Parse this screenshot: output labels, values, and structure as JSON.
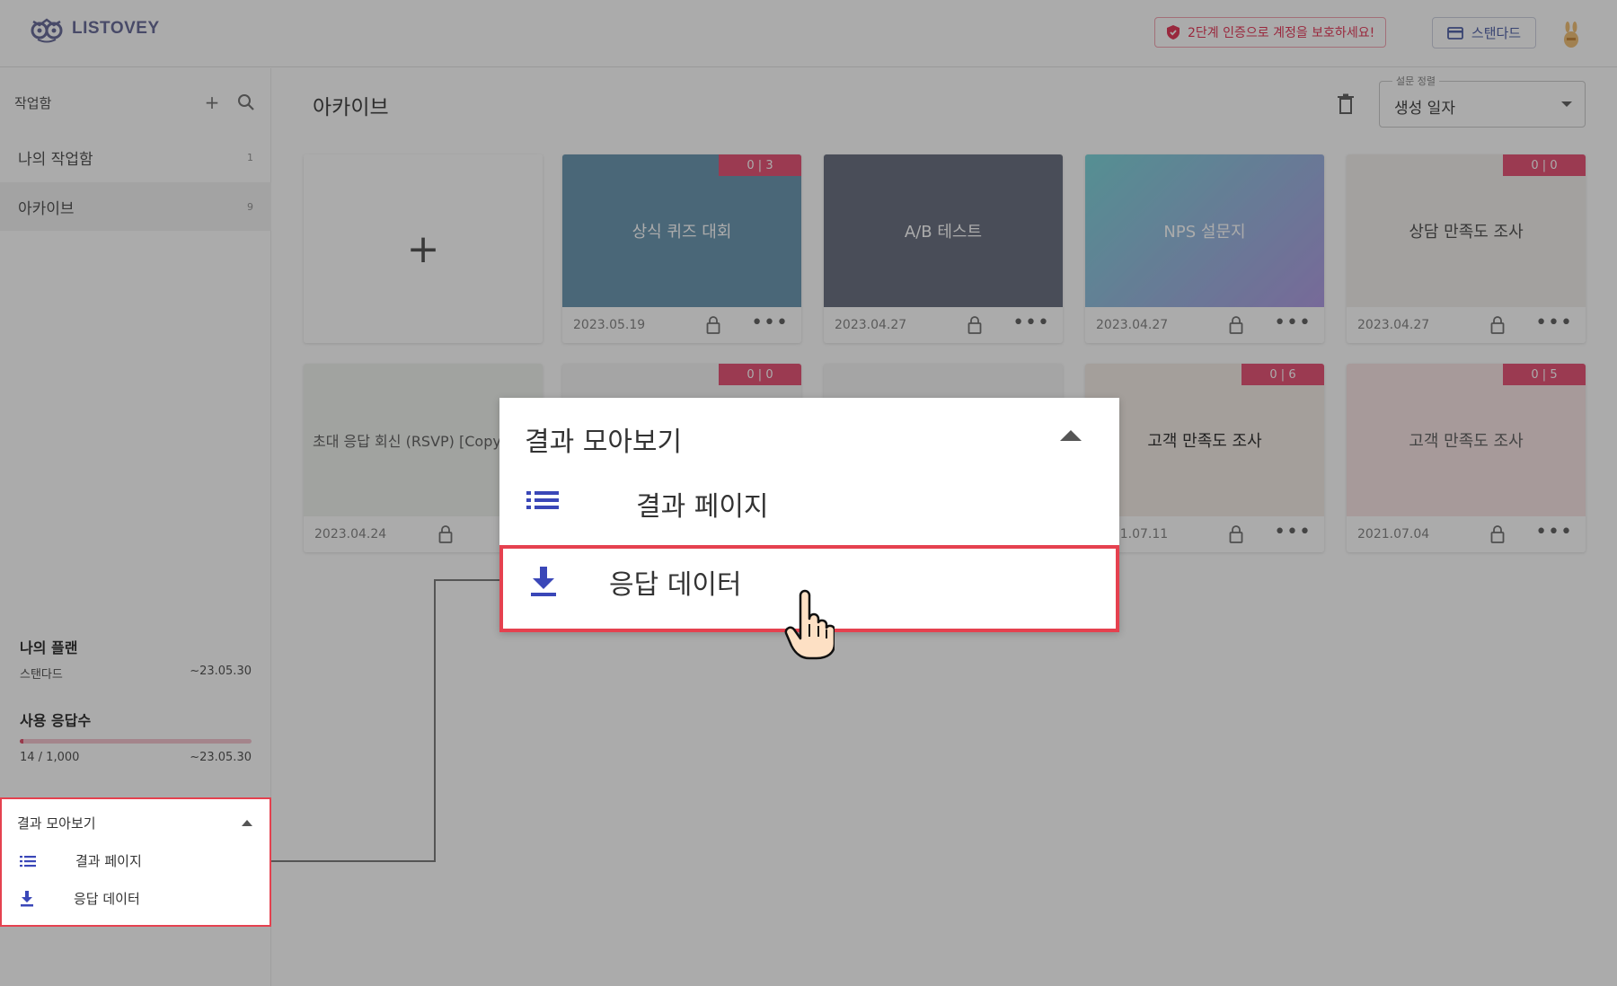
{
  "header": {
    "logo_text": "LISTOVEY",
    "security_notice": "2단계 인증으로 계정을 보호하세요!",
    "plan_button": "스탠다드"
  },
  "sidebar": {
    "title": "작업함",
    "items": [
      {
        "label": "나의 작업함",
        "count": "1"
      },
      {
        "label": "아카이브",
        "count": "9"
      }
    ],
    "plan": {
      "title": "나의 플랜",
      "name": "스탠다드",
      "expiry": "~23.05.30",
      "usage_title": "사용 응답수",
      "usage": "14 / 1,000",
      "usage_fraction": 0.014,
      "usage_expiry": "~23.05.30"
    },
    "results_menu": {
      "title": "결과 모아보기",
      "items": [
        {
          "label": "결과 페이지",
          "icon": "list-icon"
        },
        {
          "label": "응답 데이터",
          "icon": "download-icon"
        }
      ]
    }
  },
  "main": {
    "title": "아카이브",
    "sort": {
      "label": "설문 정렬",
      "value": "생성 일자"
    },
    "cards": [
      {
        "title": "",
        "date": "",
        "badge": "",
        "type": "add"
      },
      {
        "title": "상식 퀴즈 대회",
        "date": "2023.05.19",
        "badge": "0 | 3"
      },
      {
        "title": "A/B 테스트",
        "date": "2023.04.27",
        "badge": ""
      },
      {
        "title": "NPS 설문지",
        "date": "2023.04.27",
        "badge": ""
      },
      {
        "title": "상담 만족도 조사",
        "date": "2023.04.27",
        "badge": "0 | 0"
      },
      {
        "title": "초대 응답 회신 (RSVP) [Copy]",
        "date": "2023.04.24",
        "badge": ""
      },
      {
        "title": "",
        "date": "",
        "badge": "0 | 0"
      },
      {
        "title": "",
        "date": "",
        "badge": ""
      },
      {
        "title": "고객 만족도 조사",
        "date": "2021.07.11",
        "badge": "0 | 6"
      },
      {
        "title": "고객 만족도 조사",
        "date": "2021.07.04",
        "badge": "0 | 5"
      }
    ]
  },
  "popup": {
    "title": "결과 모아보기",
    "items": [
      {
        "label": "결과 페이지"
      },
      {
        "label": "응답 데이터"
      }
    ]
  },
  "colors": {
    "accent_red": "#e5414f",
    "badge_pink": "#e8577a",
    "icon_blue": "#3a47b8"
  }
}
